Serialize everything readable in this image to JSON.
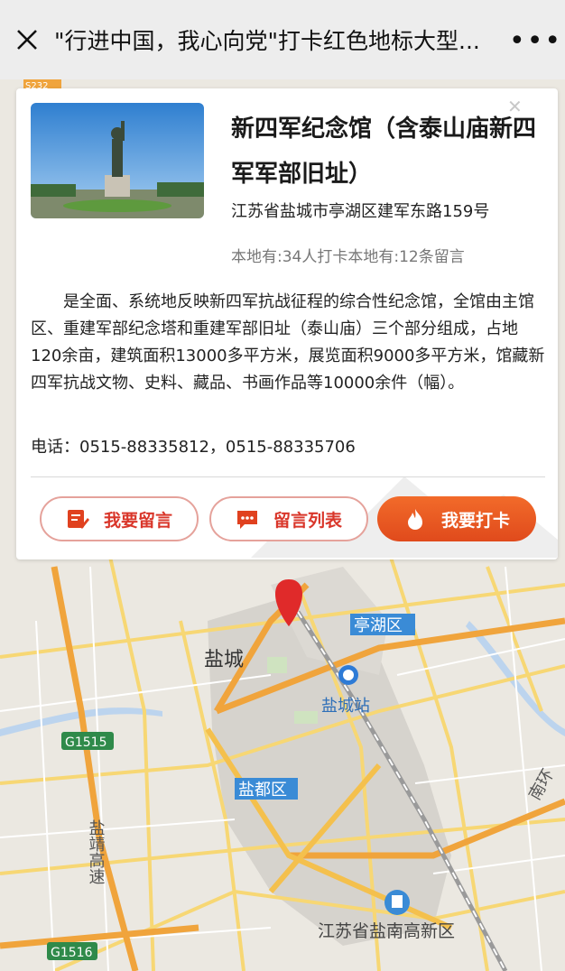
{
  "window": {
    "title": "\"行进中国，我心向党\"打卡红色地标大型..."
  },
  "card": {
    "name": "新四军纪念馆（含泰山庙新四军军部旧址）",
    "address": "江苏省盐城市亭湖区建军东路159号",
    "stats": "本地有:34人打卡本地有:12条留言",
    "description": "是全面、系统地反映新四军抗战征程的综合性纪念馆，全馆由主馆区、重建军部纪念塔和重建军部旧址（泰山庙）三个部分组成，占地120余亩，建筑面积13000多平方米，展览面积9000多平方米，馆藏新四军抗战文物、史料、藏品、书画作品等10000余件（幅）。",
    "phone": "电话：0515-88335812，0515-88335706",
    "buttons": {
      "comment": "我要留言",
      "comment_list": "留言列表",
      "checkin": "我要打卡"
    }
  },
  "map": {
    "labels": {
      "city": "盐城",
      "district_tinghu": "亭湖区",
      "station": "盐城站",
      "district_yandu": "盐都区",
      "highway_vertical": "盐靖高速",
      "highway_g1515": "G1515",
      "highway_g1516": "G1516",
      "highway_s232": "S232",
      "nanhuan": "南环",
      "hightech": "江苏省盐南高新区"
    }
  },
  "colors": {
    "accent": "#e0411f",
    "marker": "#e02a2a",
    "road_major": "#f0a43c",
    "road_minor": "#f7d774"
  }
}
